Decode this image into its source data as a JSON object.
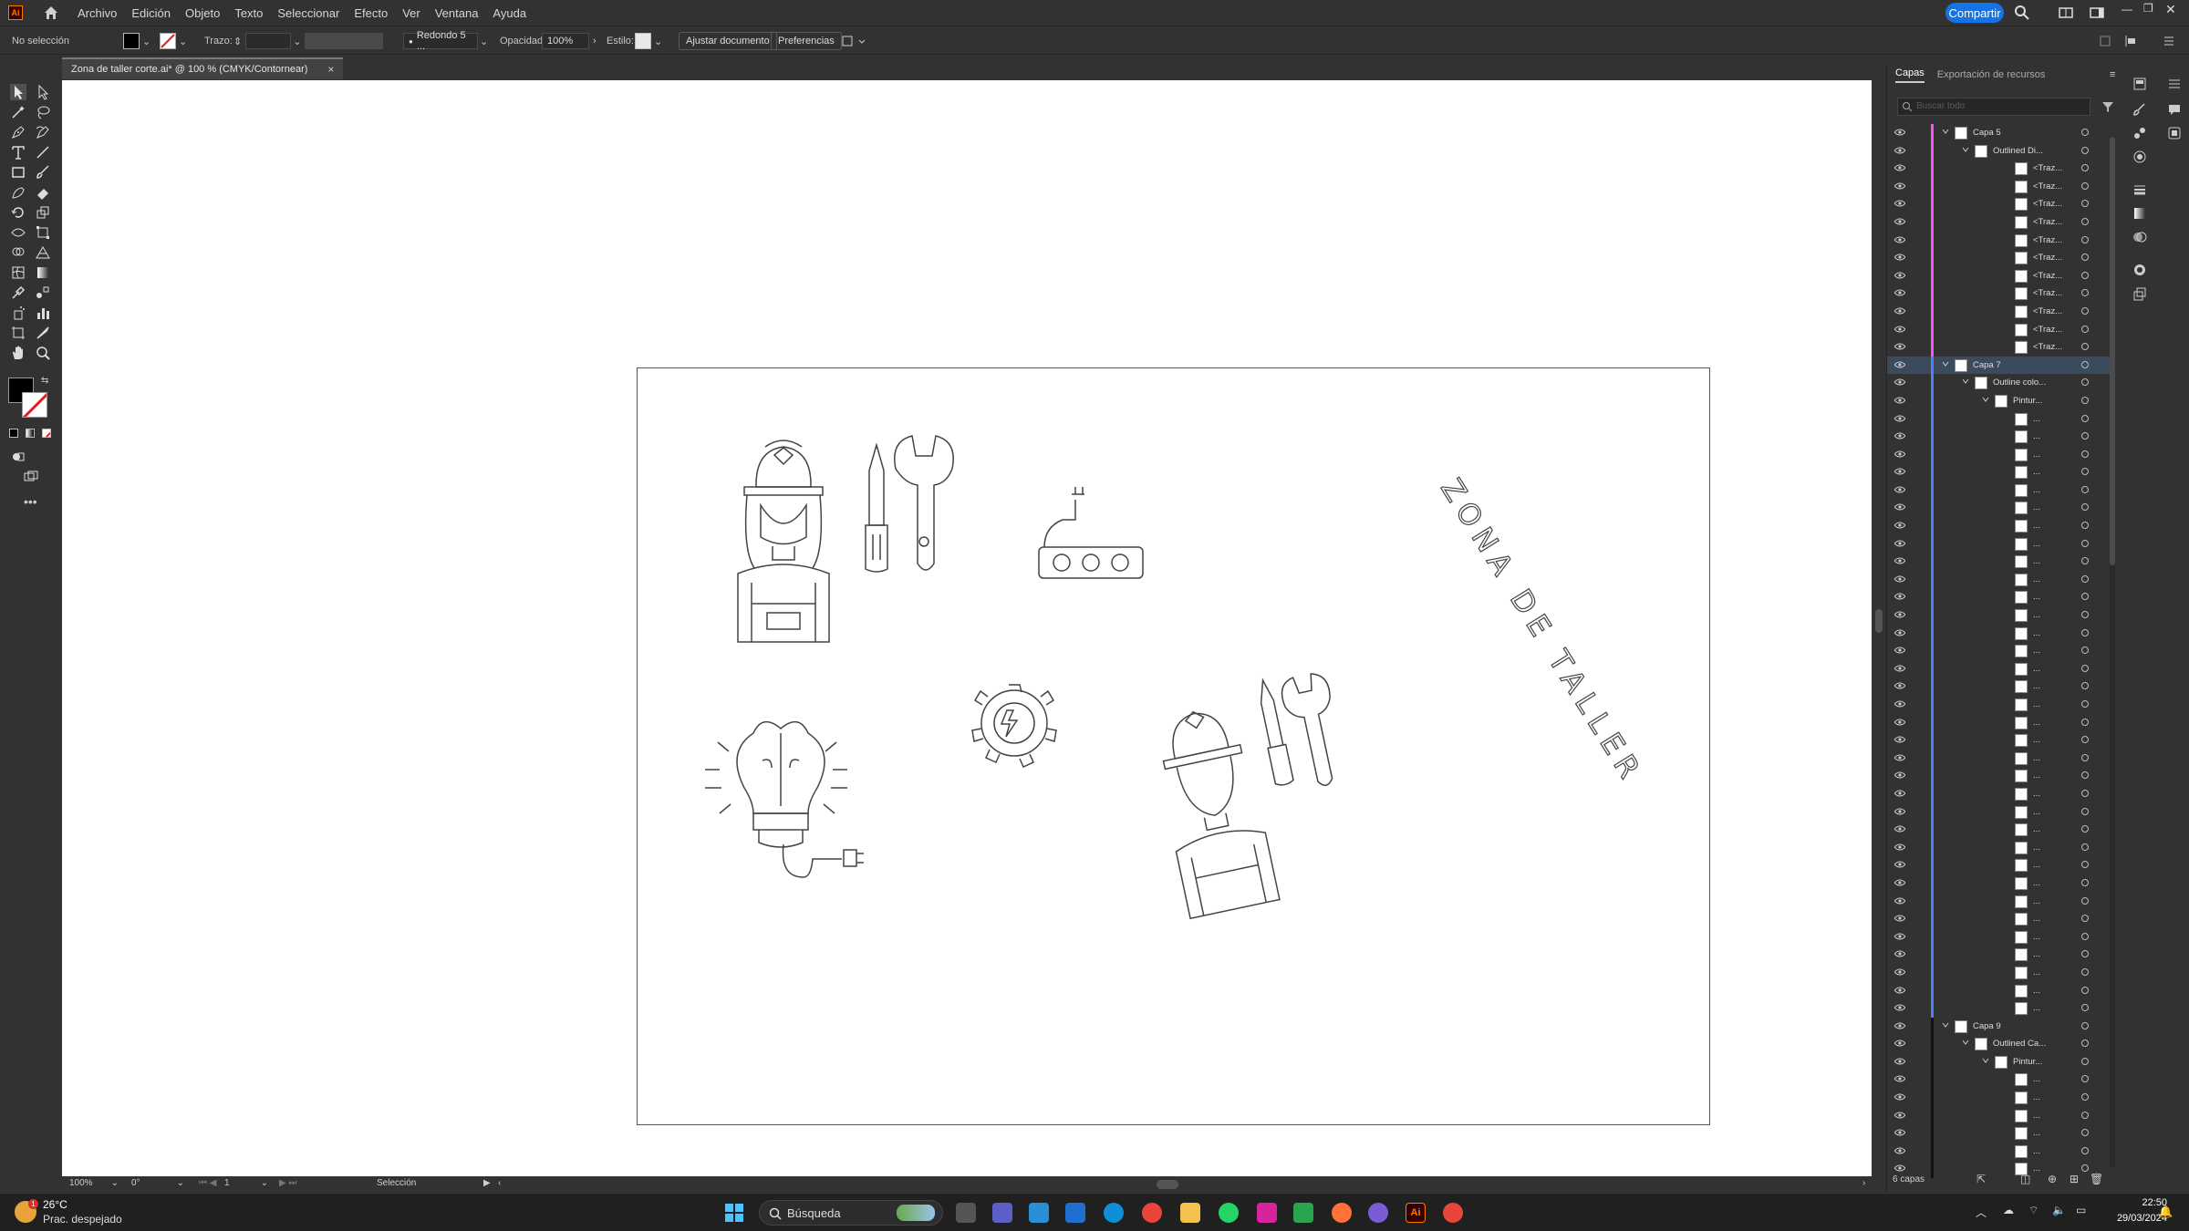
{
  "app": {
    "logo": "Ai"
  },
  "menu": [
    "Archivo",
    "Edición",
    "Objeto",
    "Texto",
    "Seleccionar",
    "Efecto",
    "Ver",
    "Ventana",
    "Ayuda"
  ],
  "share_label": "Compartir",
  "control_bar": {
    "selection_label": "No selección",
    "stroke_label": "Trazo:",
    "brush_label": "Redondo 5 ...",
    "opacity_label": "Opacidad:",
    "opacity_value": "100%",
    "style_label": "Estilo:",
    "adjust_doc_label": "Ajustar documento",
    "prefs_label": "Preferencias"
  },
  "document_tab": {
    "title": "Zona de taller corte.ai* @ 100 % (CMYK/Contornear)",
    "close": "×"
  },
  "status": {
    "zoom": "100%",
    "rotation": "0°",
    "page": "1",
    "tool": "Selección"
  },
  "artwork": {
    "title_text": "ZONA DE TALLER"
  },
  "layers_panel": {
    "tabs": [
      "Capas",
      "Exportación de recursos"
    ],
    "search_placeholder": "Buscar todo",
    "footer": "6 capas",
    "rows": [
      {
        "name": "Capa 5",
        "level": 0,
        "color": "#ff4fff",
        "twist": true
      },
      {
        "name": "Outlined Di...",
        "level": 1,
        "color": "#ff4fff",
        "twist": true
      },
      {
        "name": "<Traz...",
        "level": 3,
        "color": "#ff4fff",
        "twist": false
      },
      {
        "name": "<Traz...",
        "level": 3,
        "color": "#ff4fff",
        "twist": false
      },
      {
        "name": "<Traz...",
        "level": 3,
        "color": "#ff4fff",
        "twist": false
      },
      {
        "name": "<Traz...",
        "level": 3,
        "color": "#ff4fff",
        "twist": false
      },
      {
        "name": "<Traz...",
        "level": 3,
        "color": "#ff4fff",
        "twist": false
      },
      {
        "name": "<Traz...",
        "level": 3,
        "color": "#ff4fff",
        "twist": false
      },
      {
        "name": "<Traz...",
        "level": 3,
        "color": "#ff4fff",
        "twist": false
      },
      {
        "name": "<Traz...",
        "level": 3,
        "color": "#ff4fff",
        "twist": false
      },
      {
        "name": "<Traz...",
        "level": 3,
        "color": "#ff4fff",
        "twist": false
      },
      {
        "name": "<Traz...",
        "level": 3,
        "color": "#ff4fff",
        "twist": false
      },
      {
        "name": "<Traz...",
        "level": 3,
        "color": "#ff4fff",
        "twist": false
      },
      {
        "name": "Capa 7",
        "level": 0,
        "color": "#4f7fff",
        "twist": true,
        "selected": true
      },
      {
        "name": "Outline colo...",
        "level": 1,
        "color": "#4f7fff",
        "twist": true
      },
      {
        "name": "Pintur...",
        "level": 2,
        "color": "#4f7fff",
        "twist": true
      },
      {
        "name": "...",
        "level": 3,
        "color": "#4f7fff",
        "twist": false
      },
      {
        "name": "...",
        "level": 3,
        "color": "#4f7fff",
        "twist": false
      },
      {
        "name": "...",
        "level": 3,
        "color": "#4f7fff",
        "twist": false
      },
      {
        "name": "...",
        "level": 3,
        "color": "#4f7fff",
        "twist": false
      },
      {
        "name": "...",
        "level": 3,
        "color": "#4f7fff",
        "twist": false
      },
      {
        "name": "...",
        "level": 3,
        "color": "#4f7fff",
        "twist": false
      },
      {
        "name": "...",
        "level": 3,
        "color": "#4f7fff",
        "twist": false
      },
      {
        "name": "...",
        "level": 3,
        "color": "#4f7fff",
        "twist": false
      },
      {
        "name": "...",
        "level": 3,
        "color": "#4f7fff",
        "twist": false
      },
      {
        "name": "...",
        "level": 3,
        "color": "#4f7fff",
        "twist": false
      },
      {
        "name": "...",
        "level": 3,
        "color": "#4f7fff",
        "twist": false
      },
      {
        "name": "...",
        "level": 3,
        "color": "#4f7fff",
        "twist": false
      },
      {
        "name": "...",
        "level": 3,
        "color": "#4f7fff",
        "twist": false
      },
      {
        "name": "...",
        "level": 3,
        "color": "#4f7fff",
        "twist": false
      },
      {
        "name": "...",
        "level": 3,
        "color": "#4f7fff",
        "twist": false
      },
      {
        "name": "...",
        "level": 3,
        "color": "#4f7fff",
        "twist": false
      },
      {
        "name": "...",
        "level": 3,
        "color": "#4f7fff",
        "twist": false
      },
      {
        "name": "...",
        "level": 3,
        "color": "#4f7fff",
        "twist": false
      },
      {
        "name": "...",
        "level": 3,
        "color": "#4f7fff",
        "twist": false
      },
      {
        "name": "...",
        "level": 3,
        "color": "#4f7fff",
        "twist": false
      },
      {
        "name": "...",
        "level": 3,
        "color": "#4f7fff",
        "twist": false
      },
      {
        "name": "...",
        "level": 3,
        "color": "#4f7fff",
        "twist": false
      },
      {
        "name": "...",
        "level": 3,
        "color": "#4f7fff",
        "twist": false
      },
      {
        "name": "...",
        "level": 3,
        "color": "#4f7fff",
        "twist": false
      },
      {
        "name": "...",
        "level": 3,
        "color": "#4f7fff",
        "twist": false
      },
      {
        "name": "...",
        "level": 3,
        "color": "#4f7fff",
        "twist": false
      },
      {
        "name": "...",
        "level": 3,
        "color": "#4f7fff",
        "twist": false
      },
      {
        "name": "...",
        "level": 3,
        "color": "#4f7fff",
        "twist": false
      },
      {
        "name": "...",
        "level": 3,
        "color": "#4f7fff",
        "twist": false
      },
      {
        "name": "...",
        "level": 3,
        "color": "#4f7fff",
        "twist": false
      },
      {
        "name": "...",
        "level": 3,
        "color": "#4f7fff",
        "twist": false
      },
      {
        "name": "...",
        "level": 3,
        "color": "#4f7fff",
        "twist": false
      },
      {
        "name": "...",
        "level": 3,
        "color": "#4f7fff",
        "twist": false
      },
      {
        "name": "...",
        "level": 3,
        "color": "#4f7fff",
        "twist": false
      },
      {
        "name": "Capa 9",
        "level": 0,
        "color": "#111111",
        "twist": true
      },
      {
        "name": "Outlined Ca...",
        "level": 1,
        "color": "#111111",
        "twist": true
      },
      {
        "name": "Pintur...",
        "level": 2,
        "color": "#111111",
        "twist": true
      },
      {
        "name": "...",
        "level": 3,
        "color": "#111111",
        "twist": false
      },
      {
        "name": "...",
        "level": 3,
        "color": "#111111",
        "twist": false
      },
      {
        "name": "...",
        "level": 3,
        "color": "#111111",
        "twist": false
      },
      {
        "name": "...",
        "level": 3,
        "color": "#111111",
        "twist": false
      },
      {
        "name": "...",
        "level": 3,
        "color": "#111111",
        "twist": false
      },
      {
        "name": "...",
        "level": 3,
        "color": "#111111",
        "twist": false
      }
    ]
  },
  "taskbar": {
    "weather_temp": "26°C",
    "weather_desc": "Prac. despejado",
    "search_placeholder": "Búsqueda",
    "time": "22:50",
    "date": "29/03/2024"
  }
}
